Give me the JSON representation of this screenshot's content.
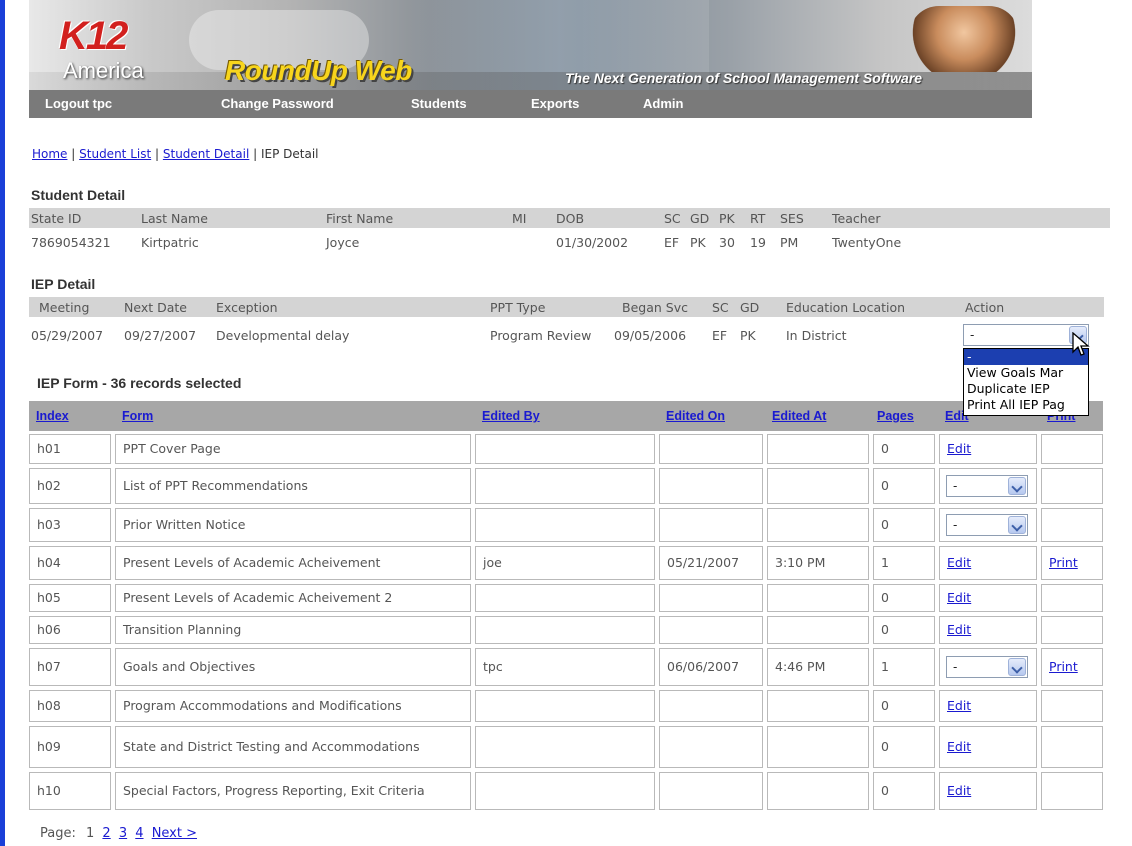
{
  "header": {
    "logo_k12": "K12",
    "logo_america": "America",
    "app_name": "RoundUp Web",
    "tagline": "The Next Generation of School Management Software",
    "nav": [
      "Logout tpc",
      "Change Password",
      "Students",
      "Exports",
      "Admin"
    ]
  },
  "breadcrumb": {
    "links": [
      "Home",
      "Student List",
      "Student Detail"
    ],
    "current": "IEP Detail",
    "separator": "|"
  },
  "student_detail": {
    "title": "Student Detail",
    "columns": [
      "State ID",
      "Last Name",
      "First Name",
      "MI",
      "DOB",
      "SC",
      "GD",
      "PK",
      "RT",
      "SES",
      "Teacher"
    ],
    "values": [
      "7869054321",
      "Kirtpatric",
      "Joyce",
      "",
      "01/30/2002",
      "EF",
      "PK",
      "30",
      "19",
      "PM",
      "TwentyOne"
    ]
  },
  "iep_detail": {
    "title": "IEP Detail",
    "columns": [
      "Meeting",
      "Next Date",
      "Exception",
      "PPT Type",
      "Began Svc",
      "SC",
      "GD",
      "Education Location",
      "Action"
    ],
    "values": [
      "05/29/2007",
      "09/27/2007",
      "Developmental delay",
      "Program Review",
      "09/05/2006",
      "EF",
      "PK",
      "In District"
    ],
    "action_select": {
      "value": "-",
      "options": [
        "-",
        "View Goals Mar",
        "Duplicate IEP",
        "Print All IEP Pag"
      ],
      "highlighted_index": 0
    }
  },
  "forms": {
    "title": "IEP Form - 36 records selected",
    "columns": [
      "Index",
      "Form",
      "Edited By",
      "Edited On",
      "Edited At",
      "Pages",
      "Edit",
      "Print"
    ],
    "rows": [
      {
        "index": "h01",
        "form": "PPT Cover Page",
        "edited_by": "",
        "edited_on": "",
        "edited_at": "",
        "pages": "0",
        "edit": "Edit",
        "print": ""
      },
      {
        "index": "h02",
        "form": "List of PPT Recommendations",
        "edited_by": "",
        "edited_on": "",
        "edited_at": "",
        "pages": "0",
        "edit_select": "-",
        "print": ""
      },
      {
        "index": "h03",
        "form": "Prior Written Notice",
        "edited_by": "",
        "edited_on": "",
        "edited_at": "",
        "pages": "0",
        "edit_select": "-",
        "print": ""
      },
      {
        "index": "h04",
        "form": "Present Levels of Academic Acheivement",
        "edited_by": "joe",
        "edited_on": "05/21/2007",
        "edited_at": "3:10 PM",
        "pages": "1",
        "edit": "Edit",
        "print": "Print"
      },
      {
        "index": "h05",
        "form": "Present Levels of Academic Acheivement 2",
        "edited_by": "",
        "edited_on": "",
        "edited_at": "",
        "pages": "0",
        "edit": "Edit",
        "print": ""
      },
      {
        "index": "h06",
        "form": "Transition Planning",
        "edited_by": "",
        "edited_on": "",
        "edited_at": "",
        "pages": "0",
        "edit": "Edit",
        "print": ""
      },
      {
        "index": "h07",
        "form": "Goals and Objectives",
        "edited_by": "tpc",
        "edited_on": "06/06/2007",
        "edited_at": "4:46 PM",
        "pages": "1",
        "edit_select": "-",
        "print": "Print"
      },
      {
        "index": "h08",
        "form": "Program Accommodations and Modifications",
        "edited_by": "",
        "edited_on": "",
        "edited_at": "",
        "pages": "0",
        "edit": "Edit",
        "print": ""
      },
      {
        "index": "h09",
        "form": "State and District Testing and Accommodations",
        "edited_by": "",
        "edited_on": "",
        "edited_at": "",
        "pages": "0",
        "edit": "Edit",
        "print": ""
      },
      {
        "index": "h10",
        "form": "Special Factors, Progress Reporting, Exit Criteria",
        "edited_by": "",
        "edited_on": "",
        "edited_at": "",
        "pages": "0",
        "edit": "Edit",
        "print": ""
      }
    ]
  },
  "pager": {
    "label": "Page:",
    "current": "1",
    "pages": [
      "2",
      "3",
      "4"
    ],
    "next": "Next >"
  },
  "colors": {
    "link": "#1a1ad0",
    "nav_bg": "#7a7a7a",
    "table_header_bg": "#a7a7a7",
    "grid_header_bg": "#d4d4d4",
    "app_name": "#f7d51d",
    "logo_red": "#d2201e"
  }
}
